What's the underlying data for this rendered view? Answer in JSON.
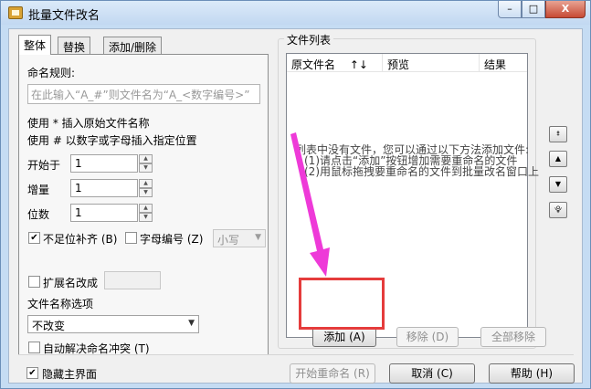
{
  "window": {
    "title": "批量文件改名",
    "controls": {
      "minimize": "–",
      "maximize": "□",
      "close": "X"
    }
  },
  "tabs": [
    {
      "label": "整体",
      "active": true
    },
    {
      "label": "替换",
      "active": false
    },
    {
      "label": "添加/删除",
      "active": false
    }
  ],
  "rule": {
    "label": "命名规则:",
    "placeholder": "在此输入“A_#”则文件名为“A_<数字编号>”"
  },
  "hints": {
    "line1": "使用 * 插入原始文件名称",
    "line2": "使用 # 以数字或字母插入指定位置"
  },
  "fields": {
    "start_label": "开始于",
    "start_value": "1",
    "step_label": "增量",
    "step_value": "1",
    "digits_label": "位数",
    "digits_value": "1"
  },
  "options": {
    "pad_label": "不足位补齐 (B)",
    "pad_checked": true,
    "letter_label": "字母编号 (Z)",
    "letter_checked": false,
    "case_value": "小写",
    "ext_label": "扩展名改成",
    "ext_checked": false,
    "name_options_label": "文件名称选项",
    "name_option_value": "不改变",
    "auto_resolve_label": "自动解决命名冲突 (T)",
    "auto_resolve_checked": false
  },
  "file_list": {
    "group_title": "文件列表",
    "columns": [
      "原文件名",
      "预览",
      "结果"
    ],
    "sort_icon": "↑↓",
    "empty_lines": [
      "列表中没有文件，您可以通过以下方法添加文件:",
      "(1)请点击“添加”按钮增加需要重命名的文件",
      "(2)用鼠标拖拽要重命名的文件到批量改名窗口上"
    ]
  },
  "side_buttons": [
    "move-top-icon",
    "move-up-icon",
    "move-down-icon",
    "move-bottom-icon"
  ],
  "list_buttons": {
    "add": "添加 (A)",
    "remove": "移除 (D)",
    "remove_all": "全部移除"
  },
  "bottom": {
    "hide_main_label": "隐藏主界面",
    "hide_main_checked": true,
    "start_rename": "开始重命名 (R)",
    "cancel": "取消 (C)",
    "help": "帮助 (H)"
  },
  "colors": {
    "highlight_box": "#e53c3c",
    "annotation_arrow": "#ee3ad8"
  }
}
